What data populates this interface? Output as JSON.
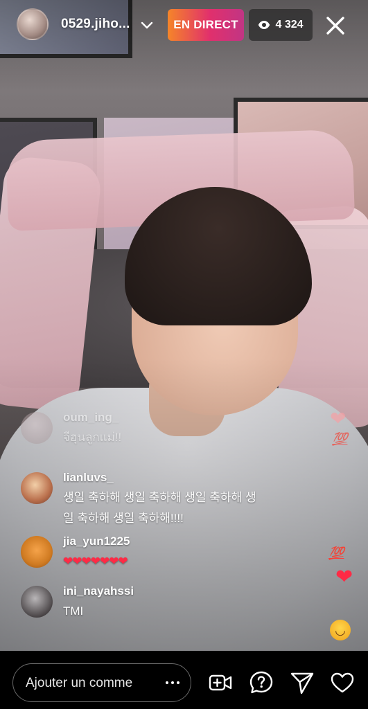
{
  "header": {
    "username": "0529.jiho...",
    "live_label": "EN DIRECT",
    "viewer_count": "4 324"
  },
  "comments": [
    {
      "user": "oum_ing_",
      "text": "จีฮุนลูกแม่!!"
    },
    {
      "user": "lianluvs_",
      "text_lines": [
        "생일 축하해 생일 축하해 생일 축하해 생",
        "일 축하해 생일 축하해!!!!"
      ]
    },
    {
      "user": "jia_yun1225",
      "text": "❤❤❤❤❤❤❤"
    },
    {
      "user": "ini_nayahssi",
      "text": "TMI"
    }
  ],
  "reactions": {
    "hundred": "💯"
  },
  "bottom_bar": {
    "comment_placeholder": "Ajouter un comme"
  },
  "colors": {
    "live_gradient": [
      "#f58529",
      "#e1306c",
      "#c13584"
    ],
    "heart": "#ff2a45",
    "bar_background": "#000000"
  }
}
